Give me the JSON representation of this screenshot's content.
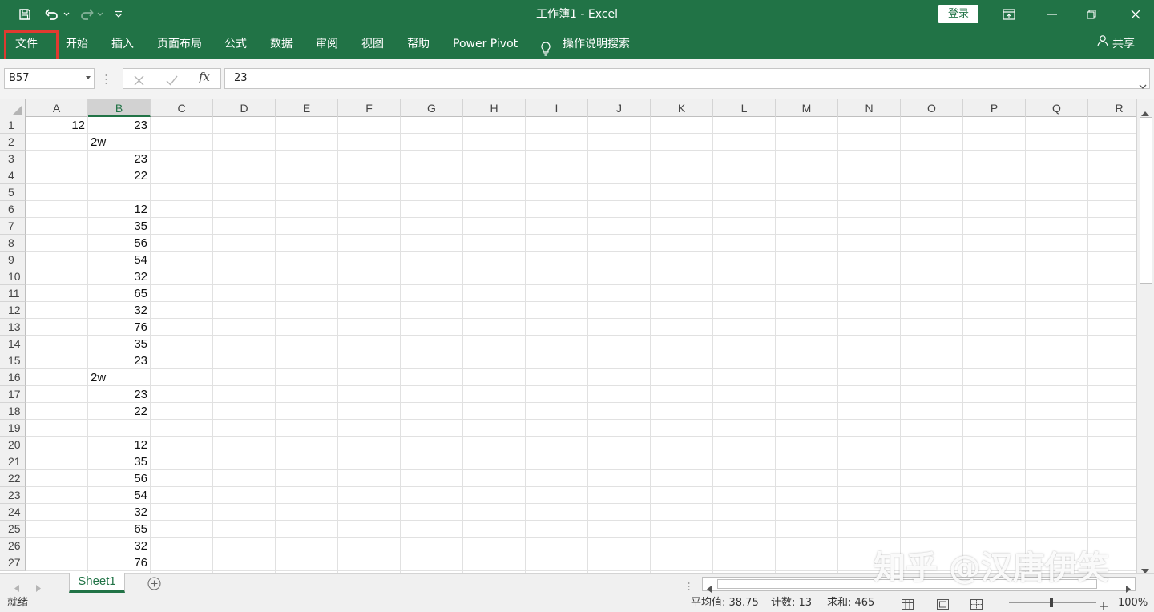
{
  "window": {
    "title": "工作簿1  -  Excel",
    "login_label": "登录"
  },
  "icons": {
    "save": "save-icon",
    "undo": "undo-icon",
    "redo": "redo-icon",
    "customize": "customize-qa-icon",
    "lightbulb": "lightbulb-icon",
    "share": "person-icon"
  },
  "ribbon": {
    "tabs": [
      "文件",
      "开始",
      "插入",
      "页面布局",
      "公式",
      "数据",
      "审阅",
      "视图",
      "帮助",
      "Power Pivot"
    ],
    "search_label": "操作说明搜索",
    "share_label": "共享"
  },
  "formula_bar": {
    "name_box": "B57",
    "fx_label": "fx",
    "value": "23"
  },
  "sheet": {
    "columns": [
      "A",
      "B",
      "C",
      "D",
      "E",
      "F",
      "G",
      "H",
      "I",
      "J",
      "K",
      "L",
      "M",
      "N",
      "O",
      "P",
      "Q",
      "R"
    ],
    "selected_column": "B",
    "rows": [
      "1",
      "2",
      "3",
      "4",
      "5",
      "6",
      "7",
      "8",
      "9",
      "10",
      "11",
      "12",
      "13",
      "14",
      "15",
      "16",
      "17",
      "18",
      "19",
      "20",
      "21",
      "22",
      "23",
      "24",
      "25",
      "26",
      "27"
    ],
    "column_a": [
      "12",
      "",
      "",
      "",
      "",
      "",
      "",
      "",
      "",
      "",
      "",
      "",
      "",
      "",
      "",
      "",
      "",
      "",
      "",
      "",
      "",
      "",
      "",
      "",
      "",
      "",
      ""
    ],
    "column_b": [
      "23",
      "2w",
      "23",
      "22",
      "",
      "12",
      "35",
      "56",
      "54",
      "32",
      "65",
      "32",
      "76",
      "35",
      "23",
      "2w",
      "23",
      "22",
      "",
      "12",
      "35",
      "56",
      "54",
      "32",
      "65",
      "32",
      "76"
    ]
  },
  "sheet_tabs": {
    "active": "Sheet1"
  },
  "status": {
    "ready": "就绪",
    "average": "平均值: 38.75",
    "count": "计数: 13",
    "sum": "求和: 465",
    "zoom": "100%"
  },
  "watermark": "知乎 @汉唐伊笑",
  "colors": {
    "excel_green": "#217346",
    "highlight_red": "#e03a30"
  }
}
